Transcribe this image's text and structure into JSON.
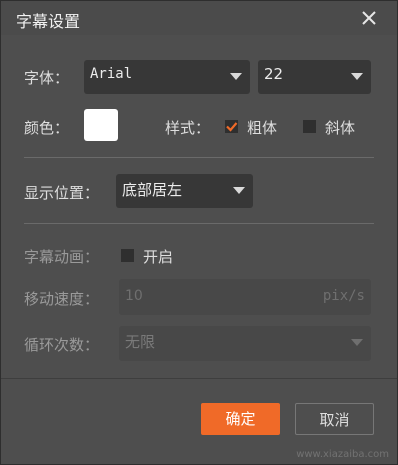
{
  "dialog": {
    "title": "字幕设置"
  },
  "font": {
    "label": "字体：",
    "family": "Arial",
    "size": "22"
  },
  "color": {
    "label": "颜色：",
    "value": "#ffffff"
  },
  "style": {
    "label": "样式：",
    "bold_label": "粗体",
    "bold_checked": true,
    "italic_label": "斜体",
    "italic_checked": false,
    "accent_color": "#f06a28"
  },
  "position": {
    "label": "显示位置：",
    "value": "底部居左"
  },
  "animation": {
    "label": "字幕动画：",
    "enable_label": "开启",
    "enabled": false
  },
  "speed": {
    "label": "移动速度：",
    "value": "10",
    "unit": "pix/s"
  },
  "loop": {
    "label": "循环次数：",
    "value": "无限"
  },
  "buttons": {
    "ok": "确定",
    "cancel": "取消"
  },
  "watermark": "www.xiazaiba.com"
}
